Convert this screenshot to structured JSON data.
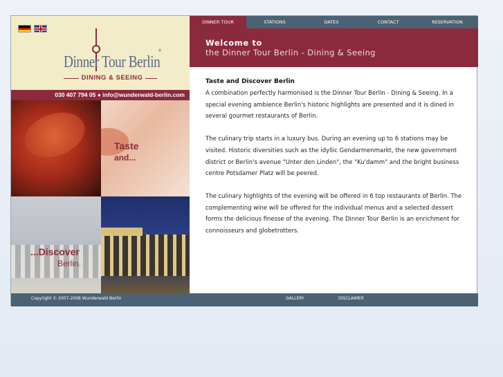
{
  "nav": {
    "dinner_tour": "DINNER TOUR",
    "stations": "STATIONS",
    "dates": "DATES",
    "contact": "CONTACT",
    "reservation": "RESERVATION"
  },
  "brand": {
    "name": "Dinner Tour Berlin",
    "tagline": "DINING & SEEING",
    "registered": "®"
  },
  "contact_bar": "030 407 794 05 ● info@wunderwald-berlin.com",
  "photos": {
    "taste": "Taste",
    "and": "and...",
    "discover": "...Discover",
    "berlin": "Berlin."
  },
  "header": {
    "welcome": "Welcome to",
    "subtitle": "the Dinner Tour Berlin - Dining & Seeing"
  },
  "main": {
    "title": "Taste and Discover Berlin",
    "paragraphs": [
      "A combination perfectly harmonised is the Dinner Tour Berlin - Dining & Seeing. In a special evening ambience Berlin's historic highlights are presented and it is dined in several gourmet restaurants of Berlin.",
      "The culinary trip starts in a luxury bus. During an evening up to 6 stations may be visited. Historic diversities such as the idyllic Gendarmenmarkt, the new government district or Berlin's avenue \"Unter den Linden\", the \"Ku'damm\" and the bright business centre Potsdamer Platz will be peered.",
      "The culinary highlights of the evening will be offered in 6 top restaurants of Berlin. The complementing wine will be offered for the individual menus and a selected dessert forms the delicious finesse of the evening. The Dinner Tour Berlin is an enrichment for connoisseurs and globetrotters."
    ]
  },
  "footer": {
    "copyright": "Copyright © 2007-2008 Wunderwald Berlin",
    "gallery": "GALLERY",
    "disclaimer": "DISCLAIMER"
  },
  "colors": {
    "accent": "#8b2a3d",
    "nav": "#4b6274",
    "logo_bg": "#f3ecc9"
  }
}
